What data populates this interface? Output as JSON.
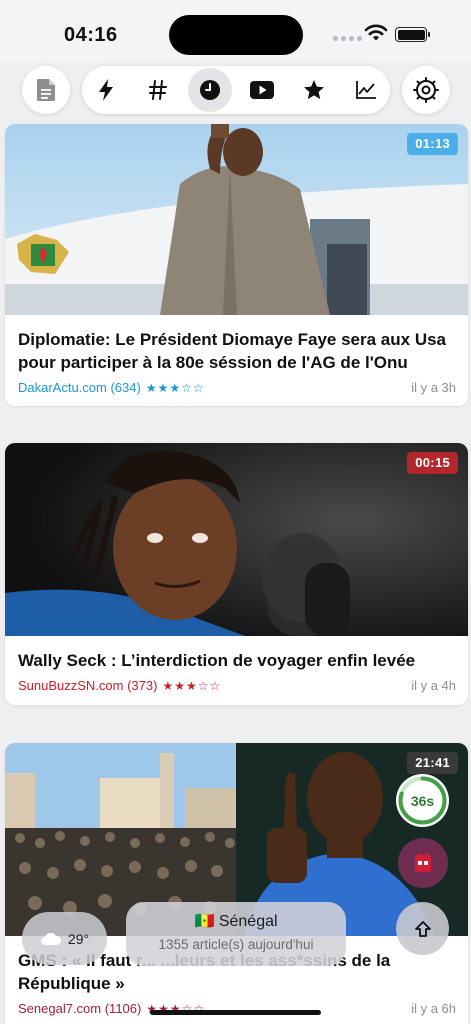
{
  "status_bar": {
    "time": "04:16"
  },
  "toolbar": {
    "left_icon": "document-icon",
    "tabs": [
      {
        "icon": "bolt-icon",
        "active": false
      },
      {
        "icon": "hashtag-icon",
        "active": false
      },
      {
        "icon": "clock-icon",
        "active": true
      },
      {
        "icon": "play-icon",
        "active": false
      },
      {
        "icon": "star-icon",
        "active": false
      },
      {
        "icon": "chart-icon",
        "active": false
      }
    ],
    "right_icon": "gear-icon"
  },
  "articles": [
    {
      "duration": "01:13",
      "duration_color": "#4aaee8",
      "title": "Diplomatie: Le Président Diomaye Faye sera aux Usa pour participer à la 80e séssion de l'AG de l'Onu",
      "source": "DakarActu.com (634)",
      "source_color": "#1a97d4",
      "stars": "★★★☆☆",
      "age": "il y a 3h"
    },
    {
      "duration": "00:15",
      "duration_color": "#b3262c",
      "title": "Wally Seck : L’interdiction de voyager enfin levée",
      "source": "SunuBuzzSN.com (373)",
      "source_color": "#c8202a",
      "stars": "★★★☆☆",
      "age": "il y a 4h"
    },
    {
      "duration": "21:41",
      "duration_color": "#3a3a3c",
      "title": "GMS : « Il faut r... ...leurs et les ass*ssins de la République »",
      "source": "Senegal7.com (1106)",
      "source_color": "#a11e3c",
      "stars": "★★★☆☆",
      "age": "il y a 6h"
    }
  ],
  "overlay": {
    "weather_temp": "29°",
    "region_flag": "🇸🇳",
    "region_name": "Sénégal",
    "region_count": "1355 article(s) aujourd'hui",
    "timer": "36s",
    "timer_progress": 0.8
  }
}
